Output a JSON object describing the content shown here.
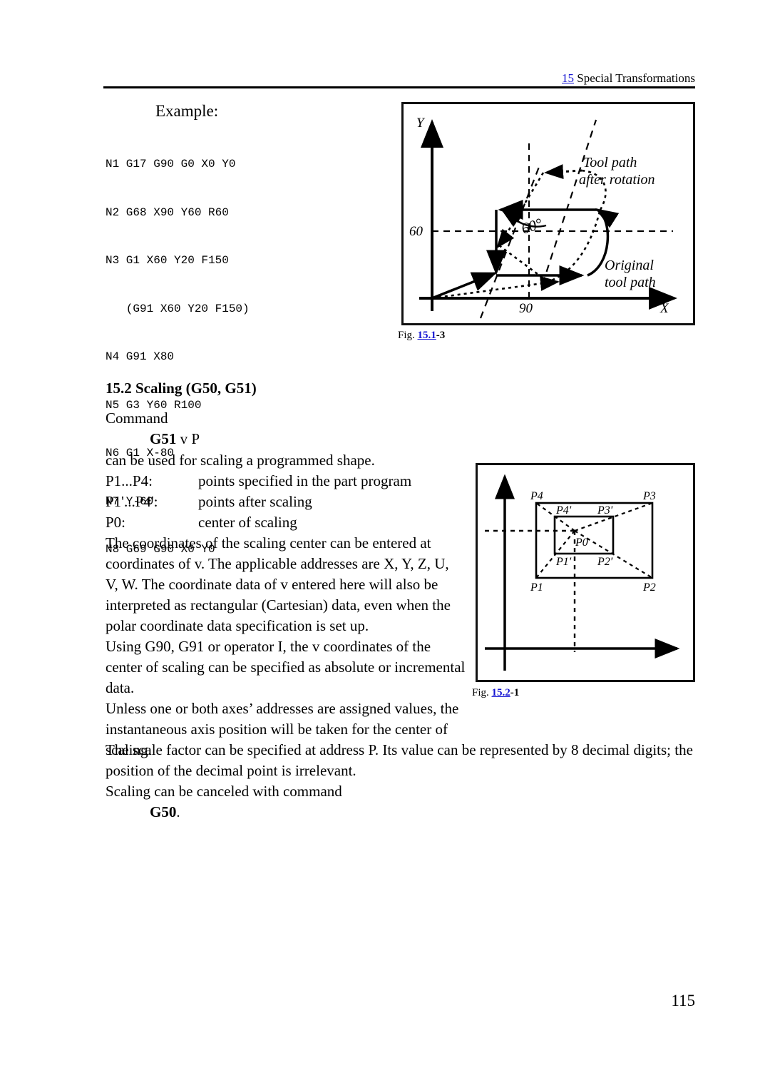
{
  "header": {
    "chapter_number": "15",
    "chapter_title": "Special Transformations"
  },
  "example": {
    "title": "Example:",
    "code_lines": [
      "N1 G17 G90 G0 X0 Y0",
      "N2 G68 X90 Y60 R60",
      "N3 G1 X60 Y20 F150",
      "   (G91 X60 Y20 F150)",
      "N4 G91 X80",
      "N5 G3 Y60 R100",
      "N6 G1 X-80",
      "N7 Y-60",
      "N8 G69 G90 X0 Y0"
    ]
  },
  "figure1": {
    "caption_prefix": "Fig.",
    "caption_number": "15.1",
    "caption_suffix": "-3",
    "axis_x_label": "X",
    "axis_y_label": "Y",
    "tick_y": "60",
    "tick_x": "90",
    "angle_label": "60°",
    "annotation_rotated_line1": "Tool path",
    "annotation_rotated_line2": "after rotation",
    "annotation_original_line1": "Original",
    "annotation_original_line2": "tool path"
  },
  "section": {
    "heading": "15.2 Scaling (G50, G51)",
    "command_label": "Command",
    "command_syntax_bold": "G51",
    "command_syntax_rest": " v P",
    "intro": "can be used for scaling a programmed shape.",
    "definitions": [
      {
        "term": "P1...P4:",
        "desc": "points specified in the part program"
      },
      {
        "term": "P1'...P4':",
        "desc": "points after scaling"
      },
      {
        "term": "P0:",
        "desc": "center of scaling"
      }
    ],
    "paragraph_narrow_lines": [
      "The coordinates of the scaling center can be entered at",
      "coordinates of v. The applicable addresses are X, Y, Z, U,",
      "V, W. The coordinate data of v entered here will also be",
      "interpreted as rectangular (Cartesian) data, even when the",
      "polar coordinate data specification is set up.",
      "Using G90, G91 or operator I, the v coordinates of the",
      "center of scaling can be specified as absolute or incremental",
      "data.",
      "Unless one or both axes’ addresses are assigned values, the",
      "instantaneous axis position will be taken for the center of",
      "scaling."
    ],
    "paragraph_wide_lines": [
      "The scale factor can be specified at address P. Its value can be represented by 8 decimal digits; the",
      "position of the decimal point is irrelevant.",
      "Scaling can be canceled with command"
    ],
    "cancel_command_bold": "G50",
    "cancel_command_rest": "."
  },
  "figure2": {
    "caption_prefix": "Fig.",
    "caption_number": "15.2",
    "caption_suffix": "-1",
    "labels": {
      "p1": "P1",
      "p2": "P2",
      "p3": "P3",
      "p4": "P4",
      "p1p": "P1'",
      "p2p": "P2'",
      "p3p": "P3'",
      "p4p": "P4'",
      "p0": "P0"
    }
  },
  "page_number": "115",
  "colors": {
    "link_blue": "#1414d2",
    "text_black": "#000000",
    "page_background": "#ffffff"
  }
}
